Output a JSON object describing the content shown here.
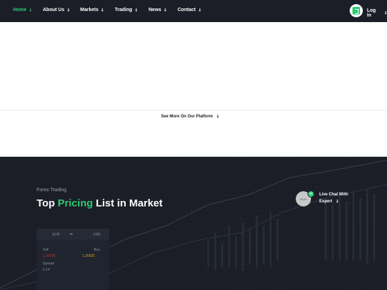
{
  "nav": {
    "items": [
      {
        "label": "Home",
        "active": true
      },
      {
        "label": "About Us",
        "active": false
      },
      {
        "label": "Markets",
        "active": false
      },
      {
        "label": "Trading",
        "active": false
      },
      {
        "label": "News",
        "active": false
      },
      {
        "label": "Contact",
        "active": false
      }
    ],
    "arrow": "↘",
    "login_label": "Log In",
    "login_icon": "login-door-icon"
  },
  "see_more": {
    "label": "See More On Our Platform",
    "arrow": "↘"
  },
  "pricing": {
    "eyebrow": "Forex Trading",
    "heading_pre": "Top ",
    "heading_highlight": "Pricing",
    "heading_post": " List in Market",
    "highlight_color": "#2ecc71"
  },
  "chat": {
    "avatar_text": "SAJD",
    "line1": "Live Chat With",
    "line2": "Expert",
    "arrow": "↘"
  },
  "card": {
    "base": "EUR",
    "swap": "⇆",
    "quote": "USD",
    "sell_label": "Sell",
    "buy_label": "Buy",
    "sell_value": "1.26735",
    "buy_value": "1.26635",
    "spread_label": "Spread",
    "spread_value": "0.14"
  },
  "colors": {
    "dark_bg": "#1b1e27",
    "accent": "#2ecc71"
  }
}
